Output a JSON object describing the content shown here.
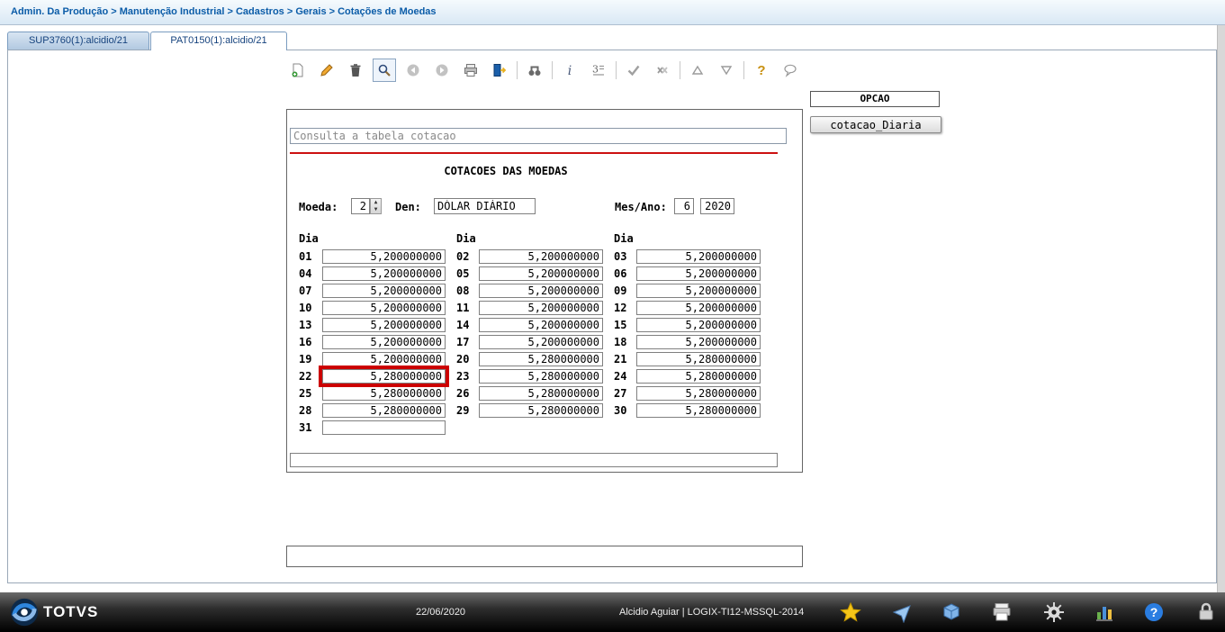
{
  "breadcrumb": "Admin. Da Produção > Manutenção Industrial > Cadastros > Gerais > Cotações de Moedas",
  "tabs": [
    {
      "label": "SUP3760(1):alcidio/21"
    },
    {
      "label": "PAT0150(1):alcidio/21"
    }
  ],
  "toolbar": {
    "icons": [
      "new",
      "edit",
      "delete",
      "search",
      "previous",
      "next",
      "print",
      "exit",
      "find-detail",
      "info",
      "record-number",
      "confirm",
      "cancel",
      "move-up",
      "move-down",
      "help",
      "comment"
    ]
  },
  "form": {
    "query_text": "Consulta a tabela cotacao",
    "title": "COTACOES DAS MOEDAS",
    "moeda_label": "Moeda:",
    "moeda_value": "2",
    "den_label": "Den:",
    "den_value": "DÓLAR DIÁRIO",
    "mes_ano_label": "Mes/Ano:",
    "mes_value": "6",
    "ano_value": "2020",
    "dia_header": "Dia",
    "message_value": "",
    "days": [
      {
        "day": "01",
        "value": "5,200000000"
      },
      {
        "day": "02",
        "value": "5,200000000"
      },
      {
        "day": "03",
        "value": "5,200000000"
      },
      {
        "day": "04",
        "value": "5,200000000"
      },
      {
        "day": "05",
        "value": "5,200000000"
      },
      {
        "day": "06",
        "value": "5,200000000"
      },
      {
        "day": "07",
        "value": "5,200000000"
      },
      {
        "day": "08",
        "value": "5,200000000"
      },
      {
        "day": "09",
        "value": "5,200000000"
      },
      {
        "day": "10",
        "value": "5,200000000"
      },
      {
        "day": "11",
        "value": "5,200000000"
      },
      {
        "day": "12",
        "value": "5,200000000"
      },
      {
        "day": "13",
        "value": "5,200000000"
      },
      {
        "day": "14",
        "value": "5,200000000"
      },
      {
        "day": "15",
        "value": "5,200000000"
      },
      {
        "day": "16",
        "value": "5,200000000"
      },
      {
        "day": "17",
        "value": "5,200000000"
      },
      {
        "day": "18",
        "value": "5,200000000"
      },
      {
        "day": "19",
        "value": "5,200000000"
      },
      {
        "day": "20",
        "value": "5,280000000"
      },
      {
        "day": "21",
        "value": "5,280000000"
      },
      {
        "day": "22",
        "value": "5,280000000",
        "highlight": true
      },
      {
        "day": "23",
        "value": "5,280000000"
      },
      {
        "day": "24",
        "value": "5,280000000"
      },
      {
        "day": "25",
        "value": "5,280000000"
      },
      {
        "day": "26",
        "value": "5,280000000"
      },
      {
        "day": "27",
        "value": "5,280000000"
      },
      {
        "day": "28",
        "value": "5,280000000"
      },
      {
        "day": "29",
        "value": "5,280000000"
      },
      {
        "day": "30",
        "value": "5,280000000"
      },
      {
        "day": "31",
        "value": ""
      }
    ]
  },
  "side_panel": {
    "opcao_label": "OPCAO",
    "button_label": "cotacao_Diaria"
  },
  "status_bar": {
    "brand": "TOTVS",
    "date": "22/06/2020",
    "user": "Alcidio Aguiar | LOGIX-TI12-MSSQL-2014",
    "icons": [
      "favorites-star",
      "shortcut",
      "apps-cube",
      "print",
      "settings-gear",
      "chart",
      "help",
      "lock"
    ]
  },
  "colors": {
    "highlight": "#cc0000",
    "accent_blue": "#1b64b0"
  }
}
